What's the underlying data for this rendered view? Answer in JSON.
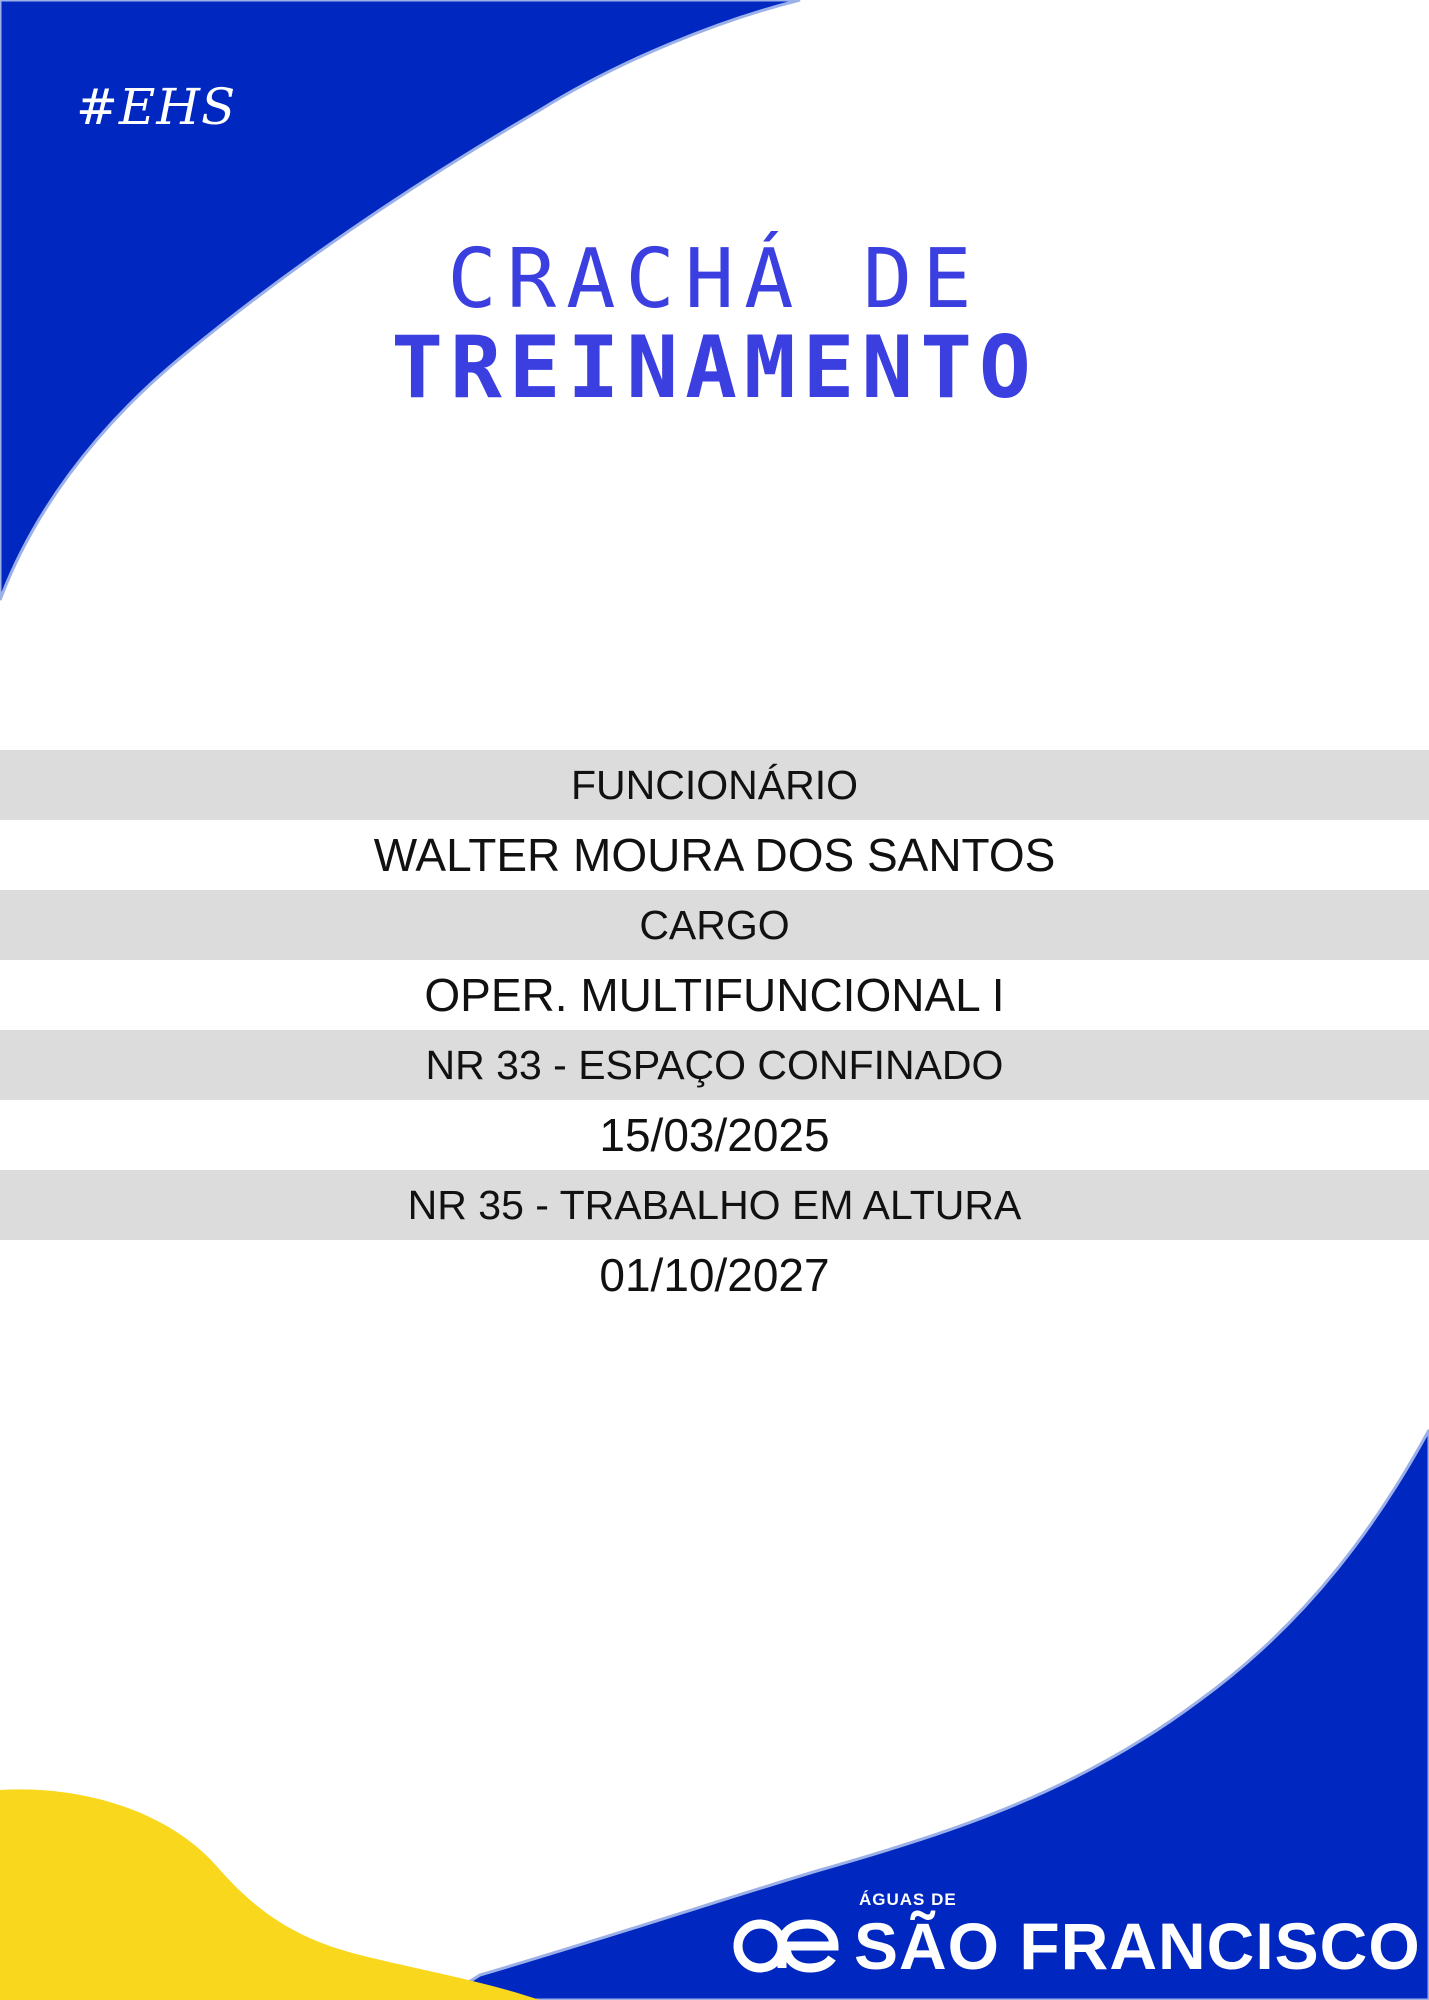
{
  "badge": {
    "hashtag": "#EHS",
    "title_line1": "CRACHÁ DE",
    "title_line2": "TREINAMENTO"
  },
  "rows": [
    {
      "text": "FUNCIONÁRIO",
      "style": "label"
    },
    {
      "text": "WALTER MOURA DOS SANTOS",
      "style": "value"
    },
    {
      "text": "CARGO",
      "style": "label"
    },
    {
      "text": "OPER. MULTIFUNCIONAL I",
      "style": "value"
    },
    {
      "text": "NR 33 - ESPAÇO CONFINADO",
      "style": "label"
    },
    {
      "text": "15/03/2025",
      "style": "value"
    },
    {
      "text": "NR 35 - TRABALHO EM ALTURA",
      "style": "label"
    },
    {
      "text": "01/10/2027",
      "style": "value"
    }
  ],
  "logo": {
    "small_text": "ÁGUAS DE",
    "main_text": "SÃO FRANCISCO",
    "mark_icon": "ae-logo-mark-icon"
  },
  "colors": {
    "blue": "#0028c0",
    "title_blue": "#3b3fe0",
    "yellow": "#f9d71c",
    "row_grey": "#dcdcdc"
  }
}
